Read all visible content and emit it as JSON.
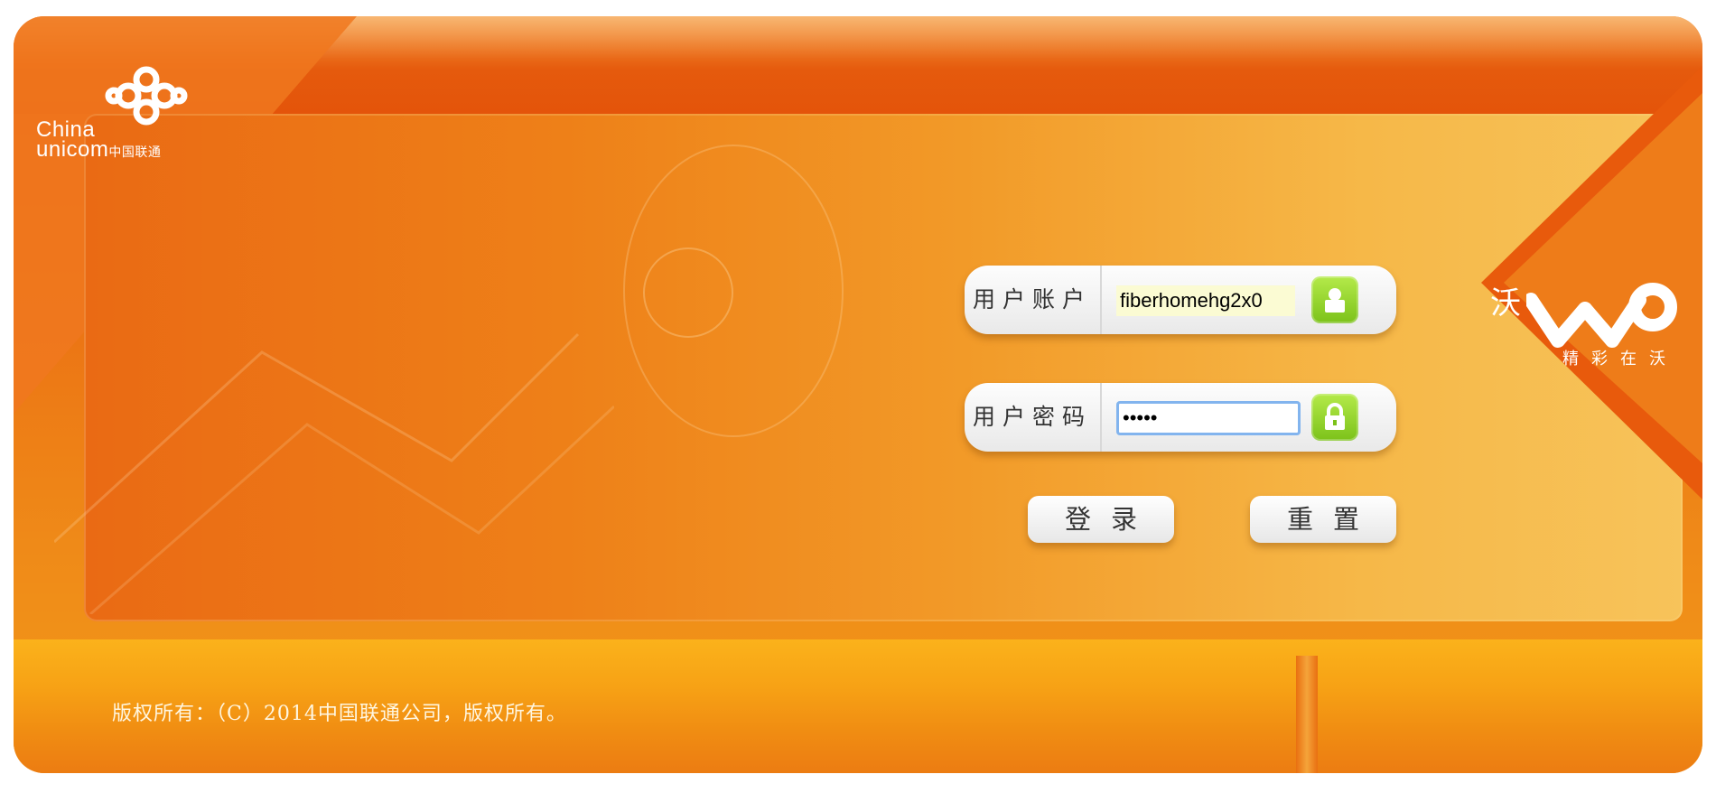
{
  "brand": {
    "logo_line1": "China",
    "logo_line2": "unicom",
    "logo_cn": "中国联通",
    "wo_char": "沃",
    "wo_slogan": "精彩在沃"
  },
  "login": {
    "username_label": "用户账户",
    "username_value": "fiberhomehg2x0",
    "password_label": "用户密码",
    "password_value": "•••••",
    "login_button": "登录",
    "reset_button": "重置"
  },
  "footer": {
    "copyright": "版权所有：（C）2014中国联通公司，版权所有。"
  },
  "colors": {
    "primary_orange": "#ec7414",
    "accent_green": "#7cc21a",
    "bottom_band": "#f7a215"
  },
  "icons": [
    "unicom-knot-icon",
    "user-lock-icon",
    "password-lock-icon",
    "wo-logo-icon"
  ]
}
